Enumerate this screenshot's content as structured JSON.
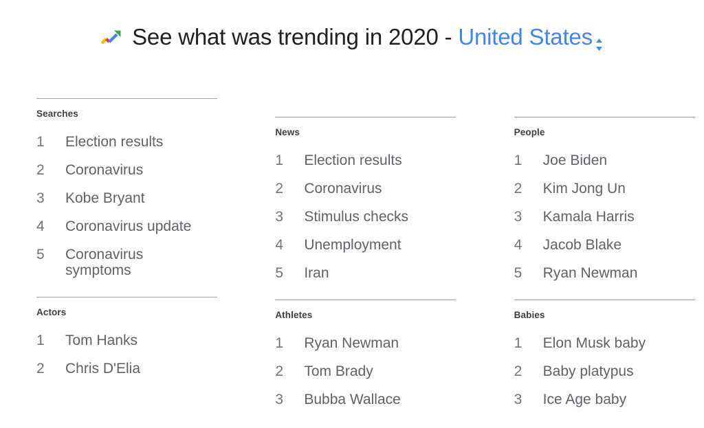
{
  "header": {
    "icon": "google-trends-arrow-icon",
    "title_prefix": "See what was trending in 2020 - ",
    "region": "United States",
    "region_selector_icon": "chevron-up-down-icon",
    "accent_color": "#4285f4",
    "title_color": "#202124"
  },
  "categories": [
    {
      "title": "Searches",
      "items": [
        {
          "rank": "1",
          "label": "Election results"
        },
        {
          "rank": "2",
          "label": "Coronavirus"
        },
        {
          "rank": "3",
          "label": "Kobe Bryant"
        },
        {
          "rank": "4",
          "label": "Coronavirus update"
        },
        {
          "rank": "5",
          "label": "Coronavirus symptoms"
        }
      ]
    },
    {
      "title": "Actors",
      "items": [
        {
          "rank": "1",
          "label": "Tom Hanks"
        },
        {
          "rank": "2",
          "label": "Chris D'Elia"
        }
      ]
    },
    {
      "title": "News",
      "items": [
        {
          "rank": "1",
          "label": "Election results"
        },
        {
          "rank": "2",
          "label": "Coronavirus"
        },
        {
          "rank": "3",
          "label": "Stimulus checks"
        },
        {
          "rank": "4",
          "label": "Unemployment"
        },
        {
          "rank": "5",
          "label": "Iran"
        }
      ]
    },
    {
      "title": "Athletes",
      "items": [
        {
          "rank": "1",
          "label": "Ryan Newman"
        },
        {
          "rank": "2",
          "label": "Tom Brady"
        },
        {
          "rank": "3",
          "label": "Bubba Wallace"
        }
      ]
    },
    {
      "title": "People",
      "items": [
        {
          "rank": "1",
          "label": "Joe Biden"
        },
        {
          "rank": "2",
          "label": "Kim Jong Un"
        },
        {
          "rank": "3",
          "label": "Kamala Harris"
        },
        {
          "rank": "4",
          "label": "Jacob Blake"
        },
        {
          "rank": "5",
          "label": "Ryan Newman"
        }
      ]
    },
    {
      "title": "Babies",
      "items": [
        {
          "rank": "1",
          "label": "Elon Musk baby"
        },
        {
          "rank": "2",
          "label": "Baby platypus"
        },
        {
          "rank": "3",
          "label": "Ice Age baby"
        }
      ]
    }
  ]
}
